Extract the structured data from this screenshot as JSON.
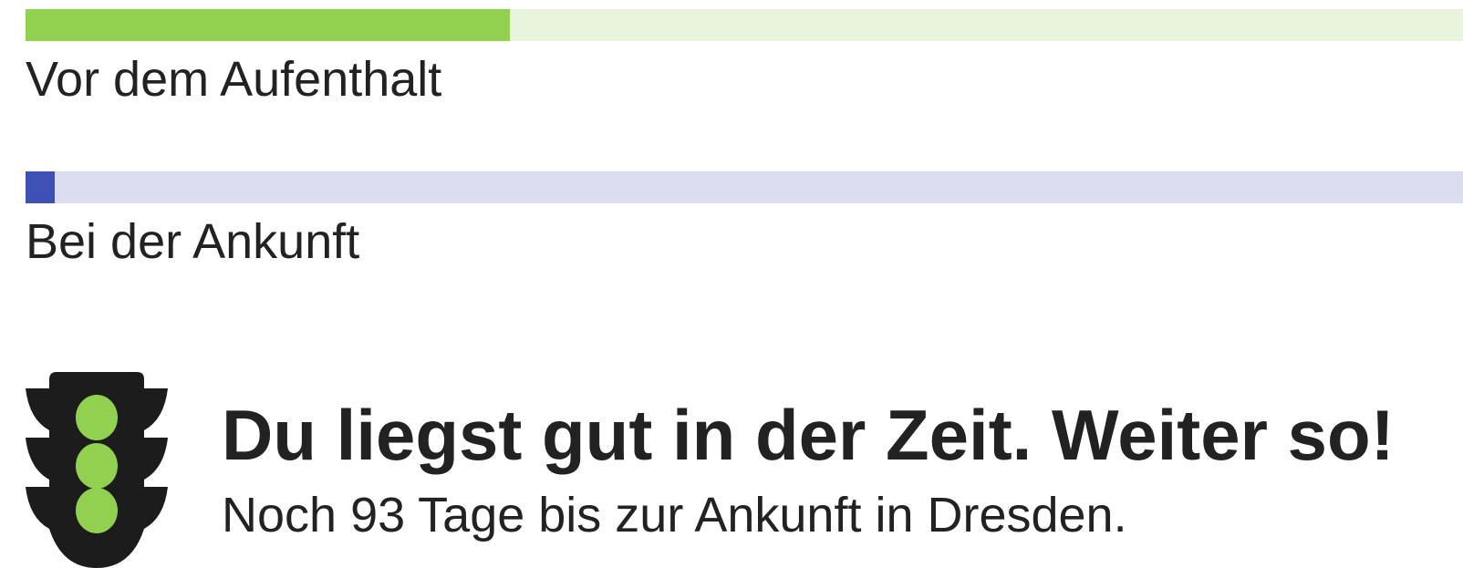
{
  "progress_bars": [
    {
      "label": "Vor dem Aufenthalt",
      "progress_fraction": 0.337,
      "fill_color": "#92d050",
      "track_color": "#e8f5dc"
    },
    {
      "label": "Bei der Ankunft",
      "progress_fraction": 0.02,
      "fill_color": "#3f51b5",
      "track_color": "#dadcf0"
    }
  ],
  "status": {
    "icon": "traffic-light-icon",
    "light_color": "#92d050",
    "body_color": "#1c1c1c",
    "headline": "Du liegst gut in der Zeit. Weiter so!",
    "subline": "Noch 93 Tage bis zur Ankunft in Dresden."
  }
}
